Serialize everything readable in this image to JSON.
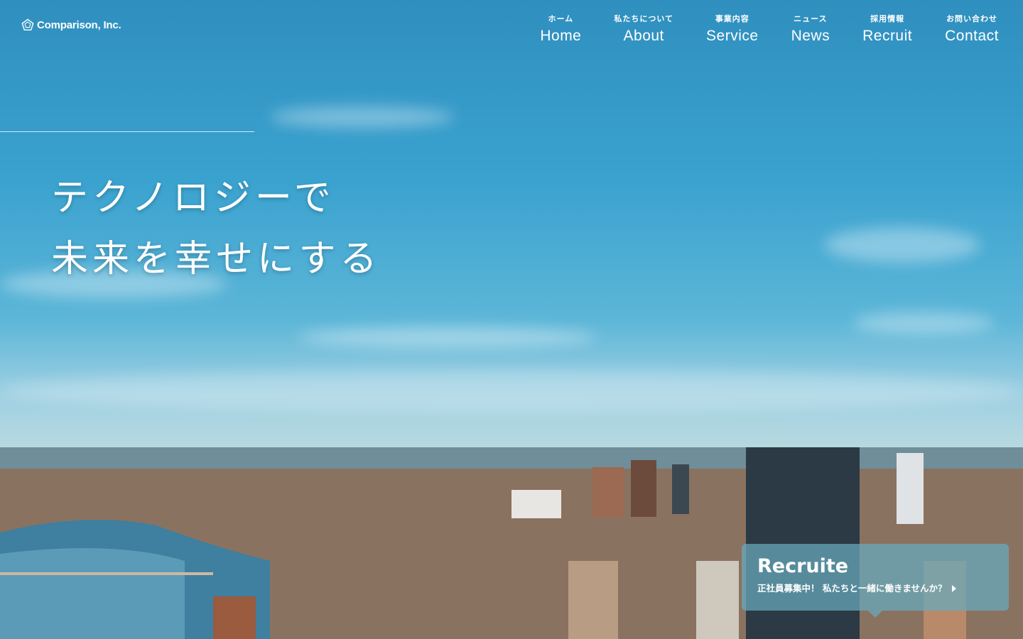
{
  "header": {
    "logo_text": "Comparison, Inc.",
    "nav": [
      {
        "ja": "ホーム",
        "en": "Home"
      },
      {
        "ja": "私たちについて",
        "en": "About"
      },
      {
        "ja": "事業内容",
        "en": "Service"
      },
      {
        "ja": "ニュース",
        "en": "News"
      },
      {
        "ja": "採用情報",
        "en": "Recruit"
      },
      {
        "ja": "お問い合わせ",
        "en": "Contact"
      }
    ]
  },
  "hero": {
    "headline_line1": "テクノロジーで",
    "headline_line2": "未来を幸せにする"
  },
  "recruit_card": {
    "title": "Recruite",
    "subtitle": "正社員募集中！ 私たちと一緒に働きませんか？"
  },
  "colors": {
    "sky_top": "#2f8fbf",
    "text": "#ffffff",
    "card_bg": "#68aabe"
  }
}
